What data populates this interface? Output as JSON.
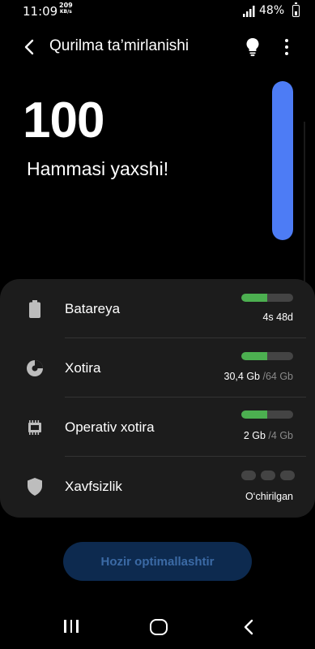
{
  "status_bar": {
    "time": "11:09",
    "speed_value": "209",
    "speed_unit": "KB/s",
    "battery_percent": "48%"
  },
  "header": {
    "title": "Qurilma ta’mirlanishi",
    "back_icon": "back-arrow-icon",
    "bulb_icon": "lightbulb-icon",
    "more_icon": "more-vertical-icon"
  },
  "score": {
    "value": "100",
    "status": "Hammasi yaxshi!",
    "level": 1.0,
    "bar_color": "#4d7cf5"
  },
  "items": [
    {
      "label": "Batareya",
      "icon": "battery-icon",
      "value": "4s 48d",
      "sub": "",
      "fill": 0.5
    },
    {
      "label": "Xotira",
      "icon": "storage-pie-icon",
      "value": "30,4 Gb ",
      "sub": "/64 Gb",
      "fill": 0.5
    },
    {
      "label": "Operativ xotira",
      "icon": "memory-chip-icon",
      "value": "2 Gb ",
      "sub": "/4 Gb",
      "fill": 0.5
    },
    {
      "label": "Xavfsizlik",
      "icon": "shield-icon",
      "value": "O‘chirilgan",
      "sub": "",
      "fill": 0
    }
  ],
  "colors": {
    "meter_fill": "#4caf50",
    "button_bg": "#0d2a4f",
    "button_text": "#3b6aa5"
  },
  "optimize_button": {
    "label": "Hozir optimallashtir"
  },
  "nav": {
    "recent_icon": "recent-apps-icon",
    "home_icon": "home-icon",
    "back_icon": "nav-back-icon"
  }
}
